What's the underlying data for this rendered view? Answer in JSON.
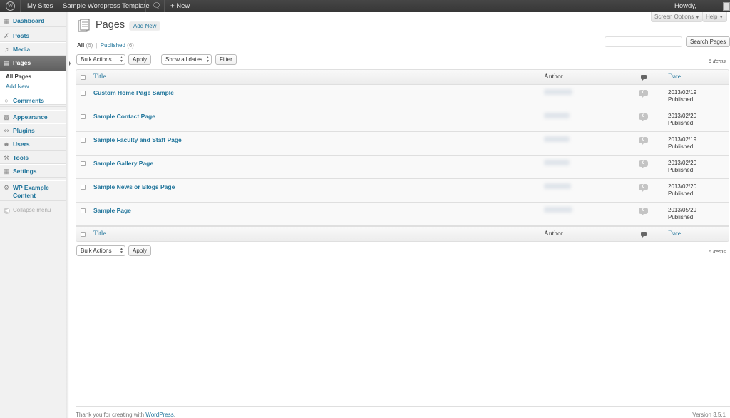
{
  "adminbar": {
    "my_sites": "My Sites",
    "site_name": "Sample Wordpress Template",
    "new_label": "New",
    "howdy": "Howdy,"
  },
  "sidebar": {
    "items": [
      {
        "label": "Dashboard",
        "icon": "dashboard-icon"
      },
      {
        "label": "Posts",
        "icon": "pin-icon"
      },
      {
        "label": "Media",
        "icon": "media-icon"
      },
      {
        "label": "Pages",
        "icon": "pages-icon"
      },
      {
        "label": "Comments",
        "icon": "comment-icon"
      },
      {
        "label": "Appearance",
        "icon": "appearance-icon"
      },
      {
        "label": "Plugins",
        "icon": "plugin-icon"
      },
      {
        "label": "Users",
        "icon": "users-icon"
      },
      {
        "label": "Tools",
        "icon": "tools-icon"
      },
      {
        "label": "Settings",
        "icon": "settings-icon"
      },
      {
        "label": "WP Example Content",
        "icon": "gear-icon"
      }
    ],
    "submenu": [
      "All Pages",
      "Add New"
    ],
    "collapse": "Collapse menu"
  },
  "screen_options": "Screen Options",
  "help": "Help",
  "page_title": "Pages",
  "add_new": "Add New",
  "views": {
    "all": "All",
    "all_count": "(6)",
    "sep": "|",
    "published": "Published",
    "published_count": "(6)"
  },
  "search_button": "Search Pages",
  "bulk_actions": "Bulk Actions",
  "apply": "Apply",
  "dates_filter": "Show all dates",
  "filter": "Filter",
  "items_count": "6 items",
  "columns": {
    "title": "Title",
    "author": "Author",
    "date": "Date"
  },
  "rows": [
    {
      "title": "Custom Home Page Sample",
      "comments": "0",
      "date": "2013/02/19",
      "status": "Published"
    },
    {
      "title": "Sample Contact Page",
      "comments": "0",
      "date": "2013/02/20",
      "status": "Published"
    },
    {
      "title": "Sample Faculty and Staff Page",
      "comments": "0",
      "date": "2013/02/19",
      "status": "Published"
    },
    {
      "title": "Sample Gallery Page",
      "comments": "0",
      "date": "2013/02/20",
      "status": "Published"
    },
    {
      "title": "Sample News or Blogs Page",
      "comments": "0",
      "date": "2013/02/20",
      "status": "Published"
    },
    {
      "title": "Sample Page",
      "comments": "0",
      "date": "2013/05/29",
      "status": "Published"
    }
  ],
  "footer": {
    "thanks": "Thank you for creating with",
    "wordpress": "WordPress",
    "version": "Version 3.5.1"
  },
  "colors": {
    "link": "#21759b",
    "current_menu": "#6d6d6d",
    "adminbar": "#464646"
  }
}
